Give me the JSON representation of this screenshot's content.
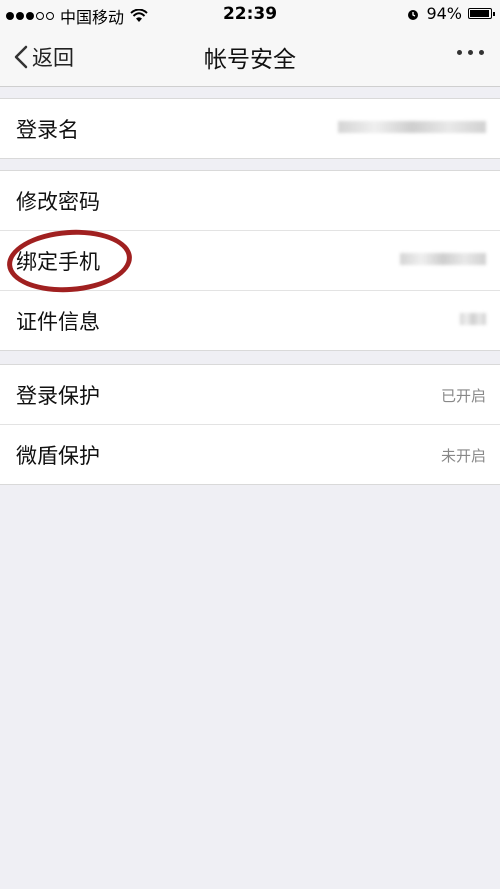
{
  "status_bar": {
    "carrier": "中国移动",
    "time": "22:39",
    "battery": "94%",
    "battery_level": 0.94
  },
  "nav": {
    "back_label": "返回",
    "title": "帐号安全"
  },
  "groups": [
    {
      "rows": [
        {
          "label": "登录名",
          "value": ""
        }
      ]
    },
    {
      "rows": [
        {
          "label": "修改密码",
          "value": ""
        },
        {
          "label": "绑定手机",
          "value": ""
        },
        {
          "label": "证件信息",
          "value": ""
        }
      ]
    },
    {
      "rows": [
        {
          "label": "登录保护",
          "value": "已开启"
        },
        {
          "label": "微盾保护",
          "value": "未开启"
        }
      ]
    }
  ],
  "colors": {
    "annotation": "#a02020",
    "background": "#efeff4"
  }
}
